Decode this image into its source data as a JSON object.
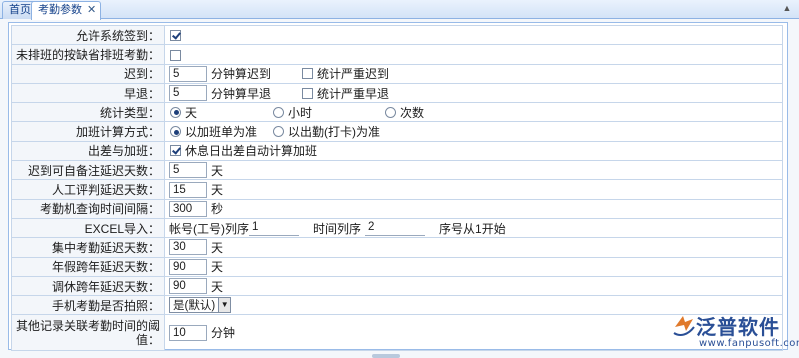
{
  "tabs": [
    {
      "label": "首页"
    },
    {
      "label": "考勤参数"
    }
  ],
  "close_glyph": "✕",
  "rows": {
    "allow_signin": {
      "label": "允许系统签到："
    },
    "unscheduled": {
      "label": "未排班的按缺省排班考勤："
    },
    "late": {
      "label": "迟到：",
      "value": "5",
      "unit": "分钟算迟到",
      "option": "统计严重迟到"
    },
    "early": {
      "label": "早退：",
      "value": "5",
      "unit": "分钟算早退",
      "option": "统计严重早退"
    },
    "stat_type": {
      "label": "统计类型：",
      "options": [
        "天",
        "小时",
        "次数"
      ]
    },
    "ot_calc": {
      "label": "加班计算方式：",
      "options": [
        "以加班单为准",
        "以出勤(打卡)为准"
      ]
    },
    "trip_ot": {
      "label": "出差与加班：",
      "option": "休息日出差自动计算加班"
    },
    "late_note_days": {
      "label": "迟到可自备注延迟天数：",
      "value": "5",
      "unit": "天"
    },
    "manual_eval_days": {
      "label": "人工评判延迟天数：",
      "value": "15",
      "unit": "天"
    },
    "query_interval": {
      "label": "考勤机查询时间间隔：",
      "value": "300",
      "unit": "秒"
    },
    "excel_import": {
      "label": "EXCEL导入：",
      "account_label": "帐号(工号)列序",
      "account_value": "1",
      "time_label": "时间列序",
      "time_value": "2",
      "note": "序号从1开始"
    },
    "central_days": {
      "label": "集中考勤延迟天数：",
      "value": "30",
      "unit": "天"
    },
    "annual_cross_days": {
      "label": "年假跨年延迟天数：",
      "value": "90",
      "unit": "天"
    },
    "comp_cross_days": {
      "label": "调休跨年延迟天数：",
      "value": "90",
      "unit": "天"
    },
    "mobile_photo": {
      "label": "手机考勤是否拍照：",
      "selected": "是(默认)"
    },
    "other_link": {
      "label": "其他记录关联考勤时间的阈值：",
      "value": "10",
      "unit": "分钟"
    }
  },
  "logo": {
    "brand": "泛普软件",
    "url": "www.fanpusoft.com"
  },
  "icons": [
    "close-icon",
    "scroll-up-icon",
    "dropdown-arrow-icon",
    "fanpu-logo-icon"
  ],
  "colors": {
    "brand": "#2a4f96",
    "tab_border": "#8db2e3",
    "grid": "#c6d6ea"
  }
}
